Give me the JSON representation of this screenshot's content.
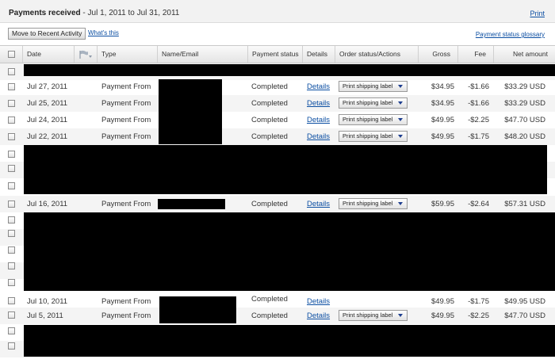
{
  "header": {
    "title_bold": "Payments received",
    "title_rest": " - Jul 1, 2011 to Jul 31, 2011",
    "print_label": "Print"
  },
  "actions": {
    "move_button": "Move to Recent Activity",
    "whats_this": "What's this",
    "glossary": "Payment status glossary"
  },
  "columns": {
    "date": "Date",
    "type": "Type",
    "name": "Name/Email",
    "status": "Payment status",
    "details": "Details",
    "order": "Order status/Actions",
    "gross": "Gross",
    "fee": "Fee",
    "net": "Net amount"
  },
  "icons": {
    "flag": "flag-icon",
    "dropdown": "chevron-down-icon"
  },
  "rows": [
    {
      "date": "Jul 27, 2011",
      "type": "Payment From",
      "status": "Completed",
      "details": "Details",
      "action": "Print shipping label",
      "gross": "$34.95",
      "fee": "-$1.66",
      "net": "$33.29 USD"
    },
    {
      "date": "Jul 25, 2011",
      "type": "Payment From",
      "status": "Completed",
      "details": "Details",
      "action": "Print shipping label",
      "gross": "$34.95",
      "fee": "-$1.66",
      "net": "$33.29 USD"
    },
    {
      "date": "Jul 24, 2011",
      "type": "Payment From",
      "status": "Completed",
      "details": "Details",
      "action": "Print shipping label",
      "gross": "$49.95",
      "fee": "-$2.25",
      "net": "$47.70 USD"
    },
    {
      "date": "Jul 22, 2011",
      "type": "Payment From",
      "status": "Completed",
      "details": "Details",
      "action": "Print shipping label",
      "gross": "$49.95",
      "fee": "-$1.75",
      "net": "$48.20 USD"
    },
    {
      "date": "Jul 16, 2011",
      "type": "Payment From",
      "status": "Completed",
      "details": "Details",
      "action": "Print shipping label",
      "gross": "$59.95",
      "fee": "-$2.64",
      "net": "$57.31 USD"
    },
    {
      "date": "Jul 10, 2011",
      "type": "Payment From",
      "status": "Completed",
      "details": "Details",
      "action": "",
      "gross": "$49.95",
      "fee": "-$1.75",
      "net": "$49.95 USD"
    },
    {
      "date": "Jul 5, 2011",
      "type": "Payment From",
      "status": "Completed",
      "details": "Details",
      "action": "Print shipping label",
      "gross": "$49.95",
      "fee": "-$2.25",
      "net": "$47.70 USD"
    }
  ]
}
